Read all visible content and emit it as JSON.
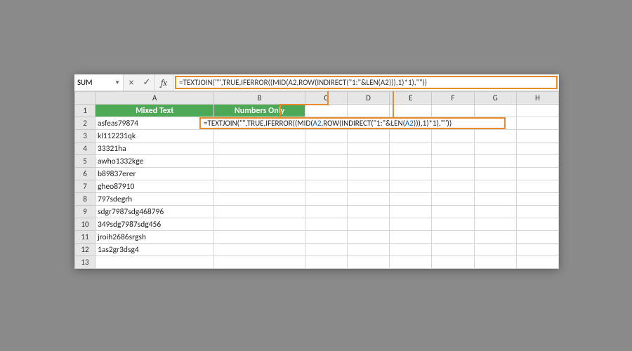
{
  "namebox": {
    "value": "SUM"
  },
  "formula_bar": {
    "fx_label": "fx",
    "formula": "=TEXTJOIN(\"\",TRUE,IFERROR((MID(A2,ROW(INDIRECT(\"1:\"&LEN(A2))),1)*1),\"\"))"
  },
  "cell_overlay": {
    "prefix": "=TEXTJOIN(",
    "q1": "\"\"",
    "mid1": ",TRUE,IFERROR((MID(",
    "ref1": "A2",
    "mid2": ",ROW(INDIRECT(",
    "q2": "\"1:\"",
    "mid3": "&LEN(",
    "ref2": "A2",
    "mid4": "))),1)*1),",
    "q3": "\"\"",
    "suffix": "))"
  },
  "columns": [
    "A",
    "B",
    "C",
    "D",
    "E",
    "F",
    "G",
    "H"
  ],
  "headers": {
    "A": "Mixed Text",
    "B": "Numbers Only"
  },
  "rows": [
    {
      "n": 1,
      "A": "",
      "B": ""
    },
    {
      "n": 2,
      "A": "asfeas79874",
      "B": ""
    },
    {
      "n": 3,
      "A": "kl112231qk",
      "B": ""
    },
    {
      "n": 4,
      "A": "33321ha",
      "B": ""
    },
    {
      "n": 5,
      "A": "awho1332kge",
      "B": ""
    },
    {
      "n": 6,
      "A": "b89837erer",
      "B": ""
    },
    {
      "n": 7,
      "A": "gheo87910",
      "B": ""
    },
    {
      "n": 8,
      "A": "797sdegrh",
      "B": ""
    },
    {
      "n": 9,
      "A": "sdgr7987sdg468796",
      "B": ""
    },
    {
      "n": 10,
      "A": "349sdg7987sdg456",
      "B": ""
    },
    {
      "n": 11,
      "A": "jroih2686srgsh",
      "B": ""
    },
    {
      "n": 12,
      "A": "1as2gr3dsg4",
      "B": ""
    },
    {
      "n": 13,
      "A": "",
      "B": ""
    }
  ]
}
